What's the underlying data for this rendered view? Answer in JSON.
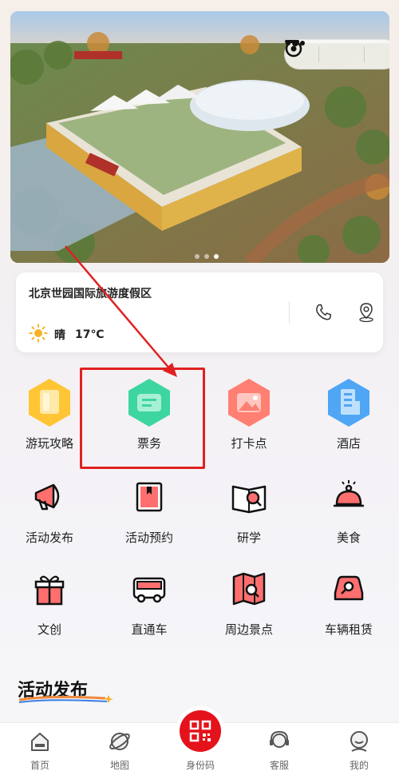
{
  "banner": {
    "page_indicator": {
      "count": 3,
      "active": 2
    }
  },
  "info": {
    "name": "北京世园国际旅游度假区",
    "weather_text": "晴",
    "temperature": "17℃"
  },
  "grid": [
    {
      "label": "游玩攻略"
    },
    {
      "label": "票务"
    },
    {
      "label": "打卡点"
    },
    {
      "label": "酒店"
    },
    {
      "label": "活动发布"
    },
    {
      "label": "活动预约"
    },
    {
      "label": "研学"
    },
    {
      "label": "美食"
    },
    {
      "label": "文创"
    },
    {
      "label": "直通车"
    },
    {
      "label": "周边景点"
    },
    {
      "label": "车辆租赁"
    }
  ],
  "section": {
    "title": "活动发布"
  },
  "tabbar": {
    "home": "首页",
    "map": "地图",
    "id_code": "身份码",
    "service": "客服",
    "mine": "我的"
  },
  "colors": {
    "accent": "#e4121a",
    "annotation": "#e02020"
  }
}
